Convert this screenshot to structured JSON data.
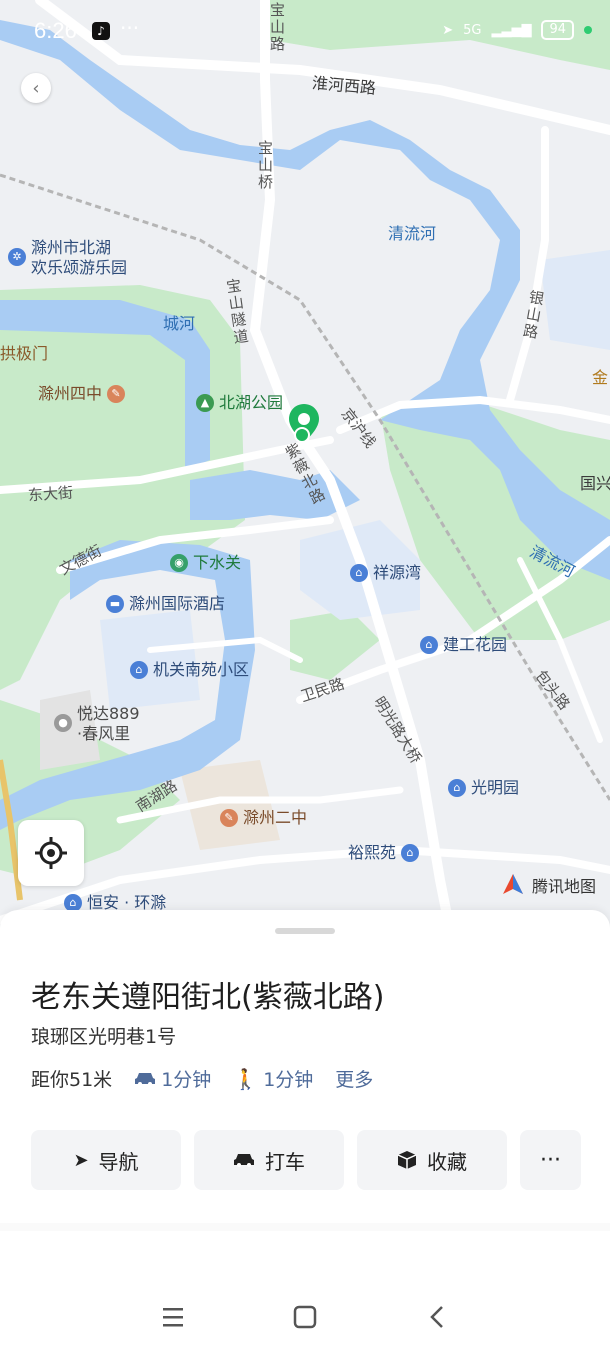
{
  "status_bar": {
    "time": "6:26",
    "network": "5G",
    "battery": "94"
  },
  "map": {
    "labels": {
      "huaihe_west_rd": "淮河西路",
      "baoshan_bridge": "宝山桥",
      "qingliu_river_1": "清流河",
      "qingliu_river_2": "清流河",
      "amusement": "滁州市北湖\n欢乐颂游乐园",
      "city_river": "城河",
      "baoshan_tunnel": "宝山隧道",
      "yinshan_rd": "银山路",
      "gongji_gate": "拱极门",
      "chuzhou_no4": "滁州四中",
      "beihu_park": "北湖公园",
      "jinghu_rail": "京沪线",
      "ziwei_north_rd": "紫薇北路",
      "guoxing": "国兴",
      "jin": "金",
      "dongda_st": "东大街",
      "wende_st": "文德街",
      "xiashuiguan": "下水关",
      "xiangyuanwan": "祥源湾",
      "intl_hotel": "滁州国际酒店",
      "jiangong_garden": "建工花园",
      "jiguan_nanyuan": "机关南苑小区",
      "baotou_rd": "包头路",
      "weimin_rd": "卫民路",
      "yueda889": "悦达889\n·春风里",
      "mingguang_bridge": "明光路大桥",
      "guangming_yuan": "光明园",
      "nanhu_rd": "南湖路",
      "chuzhou_no2": "滁州二中",
      "yuxi_yuan": "裕熙苑",
      "hengan": "恒安 · 环滁"
    },
    "brand": "腾讯地图"
  },
  "place": {
    "title": "老东关遵阳街北(紫薇北路)",
    "address": "琅琊区光明巷1号",
    "distance": "距你51米",
    "drive_time": "1分钟",
    "walk_time": "1分钟",
    "more": "更多"
  },
  "actions": {
    "navigate": "导航",
    "taxi": "打车",
    "favorite": "收藏",
    "more": "···"
  },
  "colors": {
    "water": "#a9ccf3",
    "park": "#c8eac9",
    "accent": "#4f6b9a",
    "pin": "#1eb65f"
  }
}
